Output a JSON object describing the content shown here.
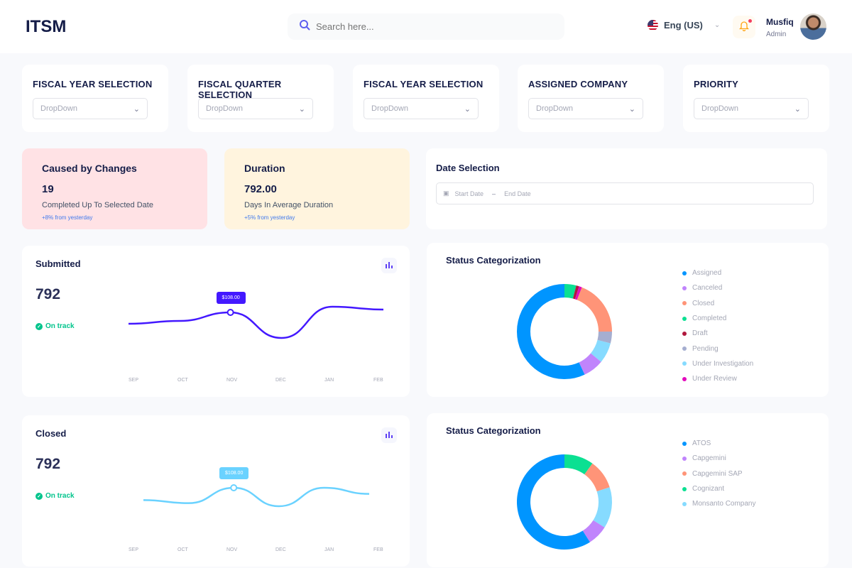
{
  "header": {
    "logo": "ITSM",
    "search_placeholder": "Search here...",
    "language": "Eng (US)",
    "user_name": "Musfiq",
    "user_role": "Admin"
  },
  "filters": [
    {
      "label": "FISCAL YEAR SELECTION",
      "value": "DropDown"
    },
    {
      "label": "FISCAL QUARTER SELECTION",
      "value": "DropDown"
    },
    {
      "label": "FISCAL YEAR SELECTION",
      "value": "DropDown"
    },
    {
      "label": "ASSIGNED COMPANY",
      "value": "DropDown"
    },
    {
      "label": "PRIORITY",
      "value": "DropDown"
    }
  ],
  "kpis": [
    {
      "title": "Caused by Changes",
      "value": "19",
      "subtitle": "Completed Up To Selected Date",
      "delta": "+8% from yesterday",
      "bg": "#ffe2e5"
    },
    {
      "title": "Duration",
      "value": "792.00",
      "subtitle": "Days In Average Duration",
      "delta": "+5% from yesterday",
      "bg": "#fff4de"
    }
  ],
  "date_selection": {
    "title": "Date Selection",
    "start_placeholder": "Start Date",
    "separator": "–",
    "end_placeholder": "End Date"
  },
  "chart_data": [
    {
      "type": "line",
      "title": "Submitted",
      "value": "792",
      "status": "On track",
      "color": "#4318ff",
      "categories": [
        "SEP",
        "OCT",
        "NOV",
        "DEC",
        "JAN",
        "FEB"
      ],
      "values": [
        100,
        102,
        108,
        90,
        112,
        110
      ],
      "tooltip": "$108.00",
      "tooltip_index": 2
    },
    {
      "type": "line",
      "title": "Closed",
      "value": "792",
      "status": "On track",
      "color": "#6ad2ff",
      "categories": [
        "SEP",
        "OCT",
        "NOV",
        "DEC",
        "JAN",
        "FEB"
      ],
      "values": [
        100,
        98,
        108,
        96,
        108,
        104
      ],
      "tooltip": "$108.00",
      "tooltip_index": 2
    },
    {
      "type": "pie",
      "title": "Status Categorization",
      "donut": true,
      "labels": [
        "Completed",
        "Draft",
        "Under Review",
        "Closed",
        "Pending",
        "Under Investigation",
        "Canceled",
        "Assigned"
      ],
      "values": [
        4,
        1,
        1,
        19,
        4,
        7,
        7,
        57
      ],
      "colors": [
        "#0be092",
        "#b0183d",
        "#e30bbd",
        "#ff9478",
        "#a5aed0",
        "#86dbff",
        "#c084fc",
        "#0095ff"
      ],
      "legend": [
        "Assigned",
        "Canceled",
        "Closed",
        "Completed",
        "Draft",
        "Pending",
        "Under Investigation",
        "Under Review"
      ],
      "legend_colors": [
        "#0095ff",
        "#c084fc",
        "#ff9478",
        "#0be092",
        "#b0183d",
        "#a5aed0",
        "#86dbff",
        "#e30bbd"
      ]
    },
    {
      "type": "pie",
      "title": "Status Categorization",
      "donut": true,
      "labels": [
        "Cognizant",
        "Capgemini SAP",
        "Monsanto Company",
        "Capgemini",
        "ATOS"
      ],
      "values": [
        10,
        10,
        14,
        7,
        59
      ],
      "colors": [
        "#0be092",
        "#ff9478",
        "#86dbff",
        "#c084fc",
        "#0095ff"
      ],
      "legend": [
        "ATOS",
        "Capgemini",
        "Capgemini SAP",
        "Cognizant",
        "Monsanto Company"
      ],
      "legend_colors": [
        "#0095ff",
        "#c084fc",
        "#ff9478",
        "#0be092",
        "#86dbff"
      ]
    }
  ]
}
